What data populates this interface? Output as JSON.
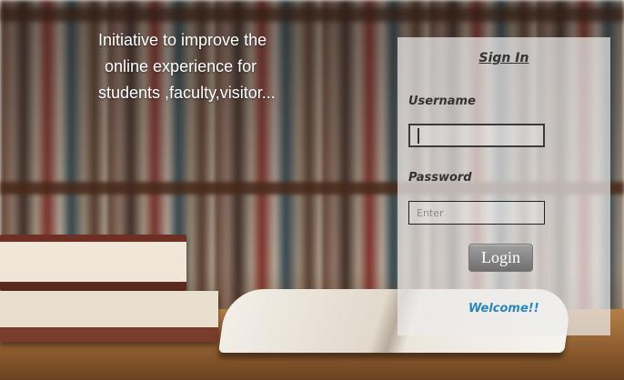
{
  "tagline": {
    "line1": "Initiative to improve the",
    "line2": "online experience for",
    "line3": "students ,faculty,visitor..."
  },
  "signin": {
    "title": "Sign In",
    "username_label": "Username",
    "username_value": "",
    "password_label": "Password",
    "password_placeholder": "Enter",
    "login_label": "Login",
    "welcome": "Welcome!!"
  },
  "colors": {
    "welcome_text": "#2a86b9",
    "button": "#8a8a8a"
  }
}
